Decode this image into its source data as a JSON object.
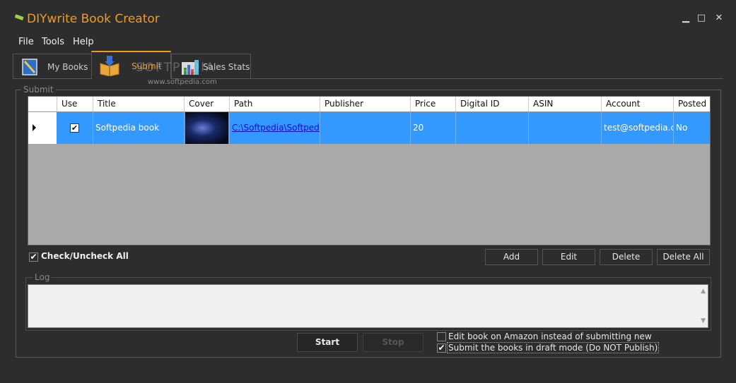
{
  "window": {
    "title": "DIYwrite Book Creator",
    "minimize": "▁",
    "maximize": "□",
    "close": "✕"
  },
  "menu": [
    "File",
    "Tools",
    "Help"
  ],
  "tabs": [
    {
      "label": "My Books",
      "icon": "book-icon"
    },
    {
      "label": "Submit",
      "icon": "submit-books-icon"
    },
    {
      "label": "Sales Stats",
      "icon": "chart-icon"
    }
  ],
  "watermark": {
    "brand": "SOFTPEDIA",
    "url": "www.softpedia.com"
  },
  "submit_group": {
    "legend": "Submit"
  },
  "grid": {
    "columns": [
      "Use",
      "Title",
      "Cover",
      "Path",
      "Publisher",
      "Price",
      "Digital ID",
      "ASIN",
      "Account",
      "Posted"
    ],
    "rows": [
      {
        "use": "✔",
        "title": "Softpedia book",
        "path": "C:\\Softpedia\\Softpedi...",
        "publisher": "",
        "price": "20",
        "digital_id": "",
        "asin": "",
        "account": "test@softpedia.c...",
        "posted": "No"
      }
    ]
  },
  "check_all": {
    "label": "Check/Uncheck All",
    "mark": "✔"
  },
  "buttons": {
    "add": "Add",
    "edit": "Edit",
    "delete": "Delete",
    "delete_all": "Delete All",
    "start": "Start",
    "stop": "Stop"
  },
  "log": {
    "legend": "Log"
  },
  "options": {
    "edit_on_amazon": {
      "label": "Edit book on Amazon instead of submitting new",
      "checked": false
    },
    "draft_mode": {
      "label": "Submit the books in draft mode (Do NOT Publish)",
      "checked": true,
      "mark": "✔"
    }
  },
  "colors": {
    "accent": "#ef9b22",
    "selection": "#3399ff",
    "background": "#2d2d2d"
  }
}
